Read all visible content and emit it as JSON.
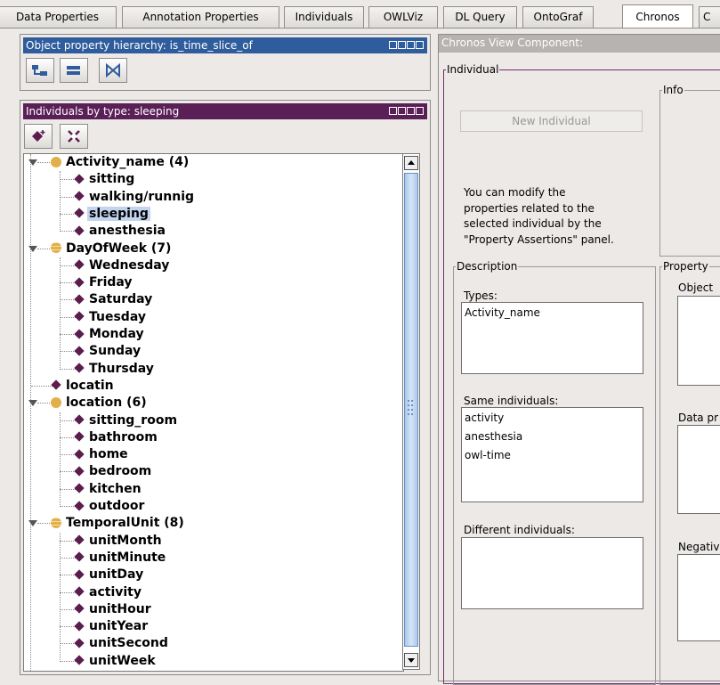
{
  "tabs": [
    {
      "label": "Data Properties",
      "active": false
    },
    {
      "label": "Annotation Properties",
      "active": false
    },
    {
      "label": "Individuals",
      "active": false
    },
    {
      "label": "OWLViz",
      "active": false
    },
    {
      "label": "DL Query",
      "active": false
    },
    {
      "label": "OntoGraf",
      "active": false
    },
    {
      "label": "Chronos",
      "active": true
    },
    {
      "label": "C",
      "active": false
    }
  ],
  "object_property_panel": {
    "title": "Object property hierarchy: is_time_slice_of"
  },
  "individuals_panel": {
    "title": "Individuals by type: sleeping"
  },
  "tree": {
    "groups": [
      {
        "label": "Activity_name (4)",
        "icon": "circle",
        "items": [
          "sitting",
          "walking/runnig",
          "sleeping",
          "anesthesia"
        ]
      },
      {
        "label": "DayOfWeek (7)",
        "icon": "striped-circle",
        "items": [
          "Wednesday",
          "Friday",
          "Saturday",
          "Tuesday",
          "Monday",
          "Sunday",
          "Thursday"
        ]
      },
      {
        "label": "locatin",
        "icon": "diamond",
        "items": []
      },
      {
        "label": "location (6)",
        "icon": "circle",
        "items": [
          "sitting_room",
          "bathroom",
          "home",
          "bedroom",
          "kitchen",
          "outdoor"
        ]
      },
      {
        "label": "TemporalUnit (8)",
        "icon": "striped-circle",
        "items": [
          "unitMonth",
          "unitMinute",
          "unitDay",
          "activity",
          "unitHour",
          "unitYear",
          "unitSecond",
          "unitWeek"
        ]
      }
    ],
    "selected": "sleeping"
  },
  "chronos": {
    "title": "Chronos View Component:",
    "individual_legend": "Individual",
    "new_individual_button": "New Individual",
    "info_legend": "Info",
    "info_text": [
      "You can modify the",
      "properties related to the",
      "selected individual by the",
      "\"Property Assertions\" panel."
    ],
    "description_legend": "Description",
    "types_label": "Types:",
    "types": [
      "Activity_name"
    ],
    "same_label": "Same individuals:",
    "same": [
      "activity",
      "anesthesia",
      "owl-time"
    ],
    "different_label": "Different individuals:",
    "different": [],
    "property_legend": "Property",
    "object_label": "Object",
    "data_label": "Data pr",
    "negative_label": "Negativ"
  },
  "colors": {
    "accent_blue": "#2f5c9c",
    "accent_purple": "#5b1f58",
    "selection": "#c3d4ee"
  }
}
